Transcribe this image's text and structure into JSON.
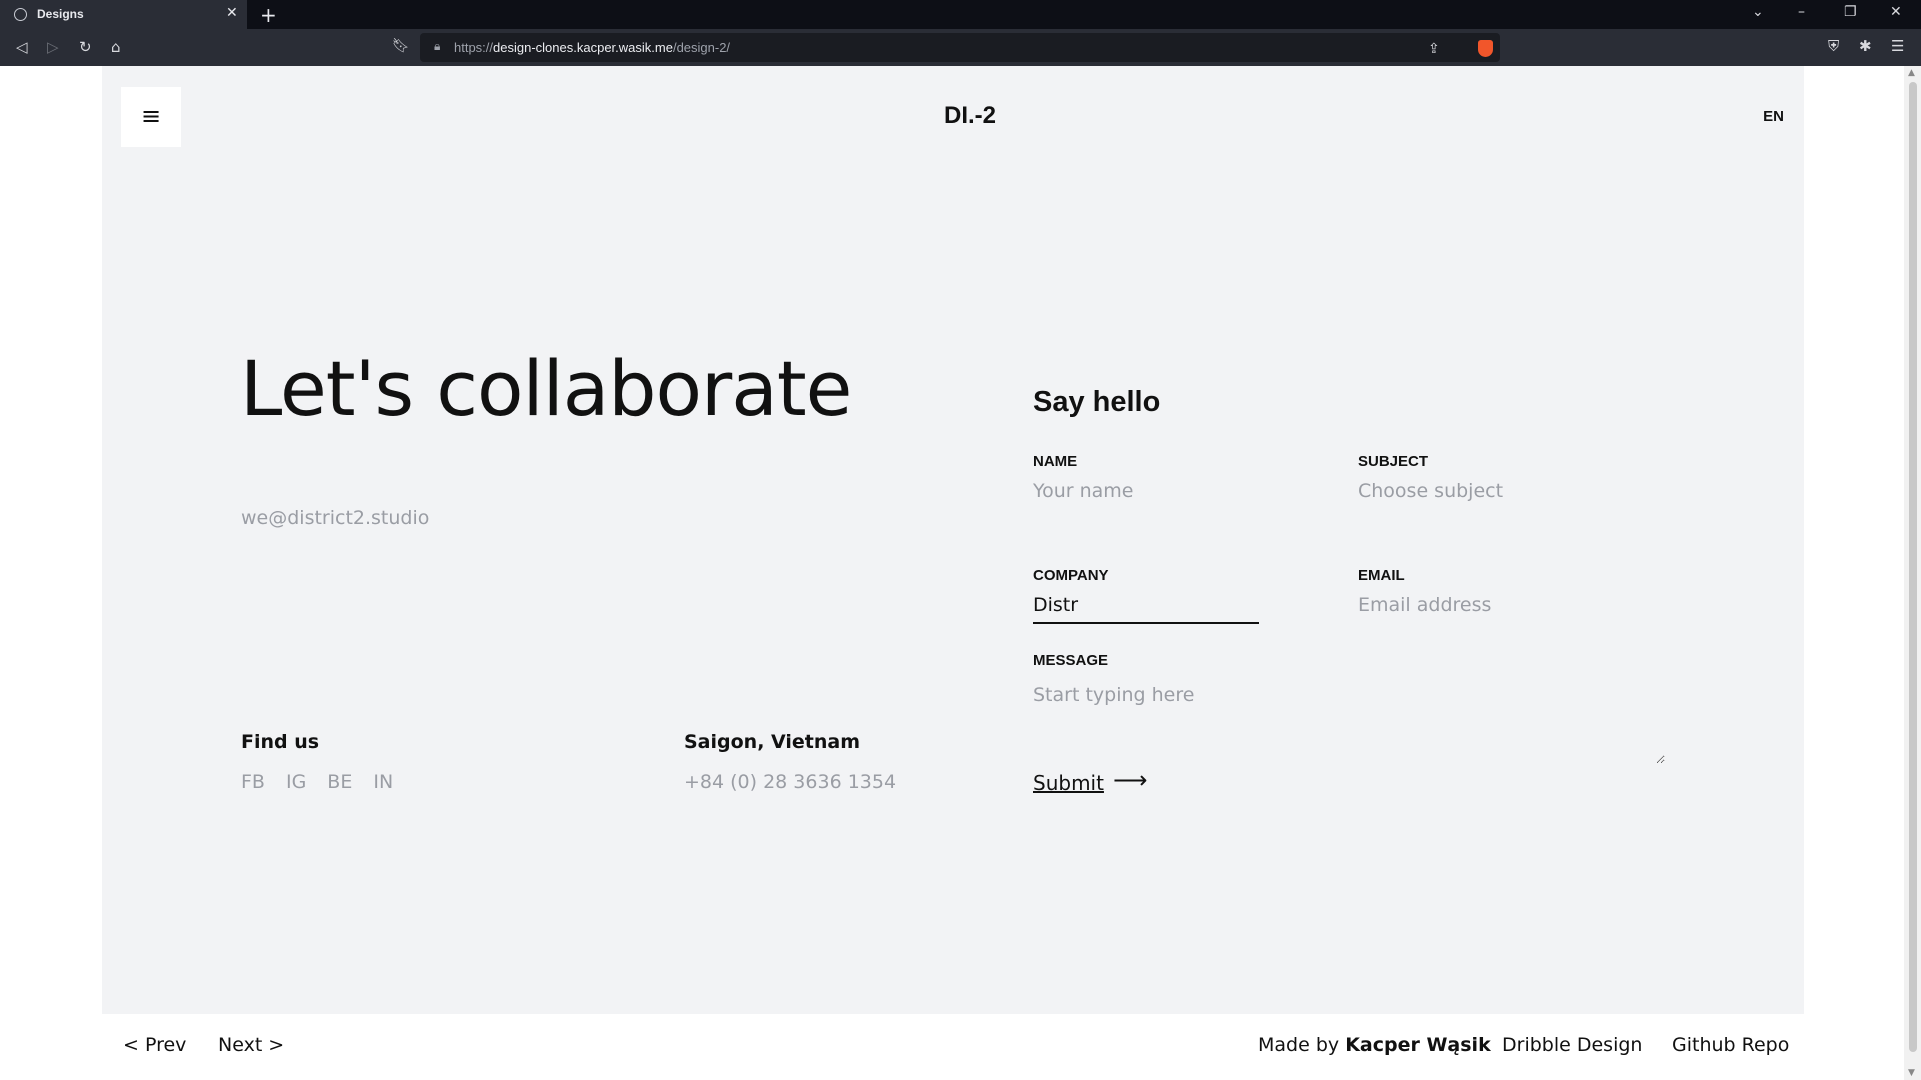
{
  "browser": {
    "tab_title": "Designs",
    "url_prefix": "https://",
    "url_domain": "design-clones.kacper.wasik.me",
    "url_path": "/design-2/"
  },
  "header": {
    "logo": "DI.-2",
    "lang": "EN",
    "menu_icon": "≡"
  },
  "hero": {
    "title": "Let's collaborate",
    "email": "we@district2.studio"
  },
  "find_us": {
    "title": "Find us",
    "socials": [
      "FB",
      "IG",
      "BE",
      "IN"
    ]
  },
  "location": {
    "city": "Saigon, Vietnam",
    "phone": "+84 (0) 28 3636 1354"
  },
  "form": {
    "title": "Say hello",
    "name_label": "NAME",
    "name_placeholder": "Your name",
    "subject_label": "SUBJECT",
    "subject_placeholder": "Choose subject",
    "company_label": "COMPANY",
    "company_value": "Distr",
    "email_label": "EMAIL",
    "email_placeholder": "Email address",
    "message_label": "MESSAGE",
    "message_placeholder": "Start typing here",
    "submit_label": "Submit",
    "submit_arrow": "⟶"
  },
  "footer": {
    "prev": "< Prev",
    "next": "Next >",
    "made_by_prefix": "Made by",
    "made_by_name": "Kacper Wąsik",
    "dribble": "Dribble Design",
    "github": "Github Repo"
  }
}
